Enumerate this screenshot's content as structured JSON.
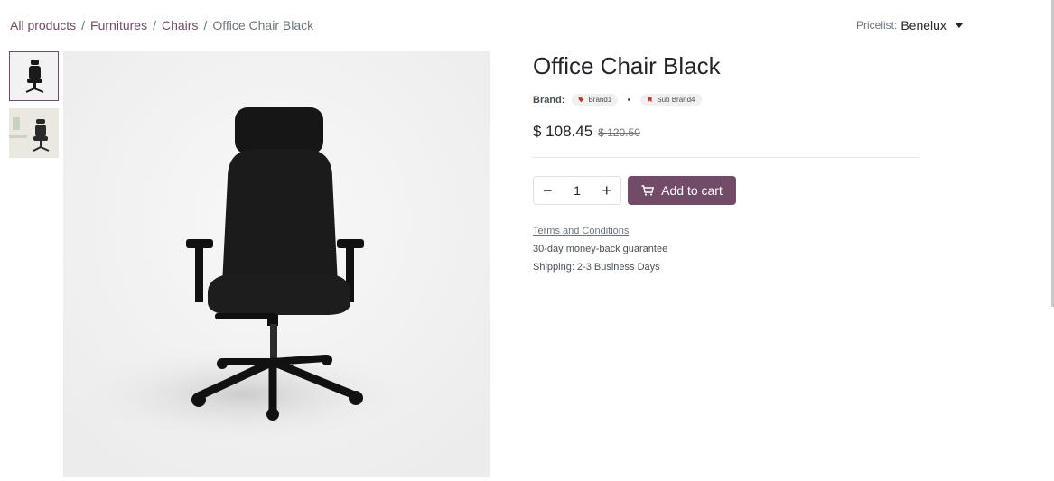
{
  "breadcrumb": {
    "items": [
      "All products",
      "Furnitures",
      "Chairs"
    ],
    "current": "Office Chair Black",
    "separator": "/"
  },
  "pricelist": {
    "label": "Pricelist:",
    "value": "Benelux"
  },
  "product": {
    "title": "Office Chair Black",
    "brand_label": "Brand:",
    "brands": [
      "Brand1",
      "Sub Brand4"
    ],
    "price": "$ 108.45",
    "old_price": "$ 120.50",
    "quantity": "1",
    "add_to_cart_label": "Add to cart",
    "terms_label": "Terms and Conditions",
    "guarantee": "30-day money-back guarantee",
    "shipping": "Shipping: 2-3 Business Days"
  },
  "colors": {
    "accent": "#714b67",
    "text": "#212529",
    "muted": "#6c757d"
  },
  "icons": [
    "tag-icon",
    "bookmark-icon",
    "cart-icon",
    "minus-icon",
    "plus-icon",
    "caret-down-icon"
  ]
}
